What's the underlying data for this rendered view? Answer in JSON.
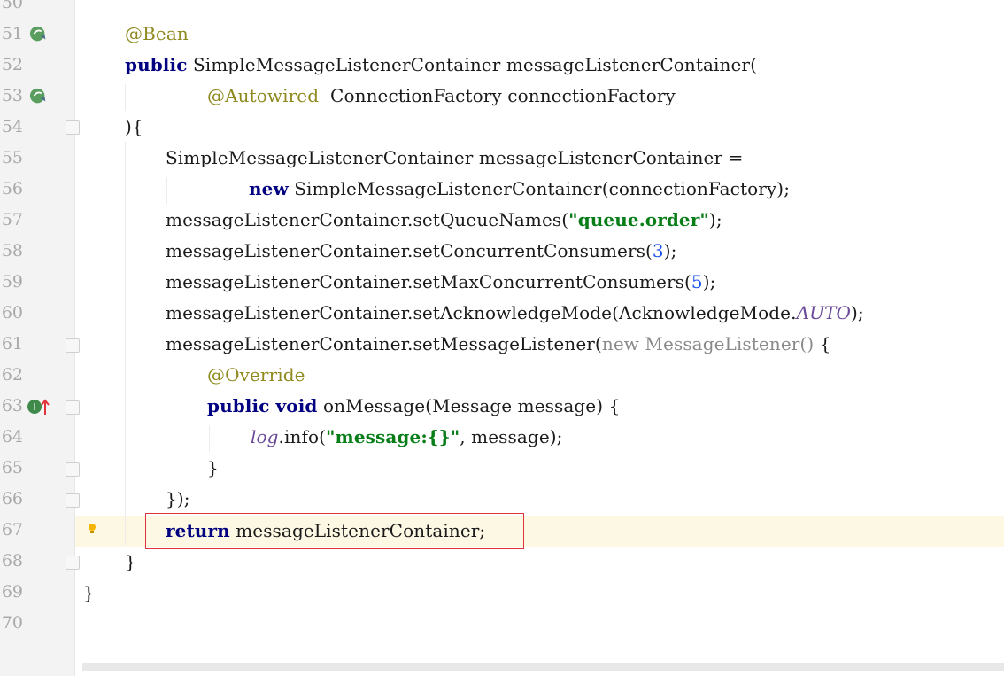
{
  "lines": [
    {
      "num": "50"
    },
    {
      "num": "51"
    },
    {
      "num": "52"
    },
    {
      "num": "53"
    },
    {
      "num": "54"
    },
    {
      "num": "55"
    },
    {
      "num": "56"
    },
    {
      "num": "57"
    },
    {
      "num": "58"
    },
    {
      "num": "59"
    },
    {
      "num": "60"
    },
    {
      "num": "61"
    },
    {
      "num": "62"
    },
    {
      "num": "63"
    },
    {
      "num": "64"
    },
    {
      "num": "65"
    },
    {
      "num": "66"
    },
    {
      "num": "67"
    },
    {
      "num": "68"
    },
    {
      "num": "69"
    },
    {
      "num": "70"
    }
  ],
  "code": {
    "l51_ann": "@Bean",
    "l52_kw": "public",
    "l52_rest": " SimpleMessageListenerContainer messageListenerContainer(",
    "l53_ann": "@Autowired",
    "l53_rest": "  ConnectionFactory connectionFactory",
    "l54": "){",
    "l55": "SimpleMessageListenerContainer messageListenerContainer =",
    "l56_kw": "new",
    "l56_rest": " SimpleMessageListenerContainer(connectionFactory);",
    "l57_a": "messageListenerContainer.setQueueNames(",
    "l57_str": "\"queue.order\"",
    "l57_b": ");",
    "l58_a": "messageListenerContainer.setConcurrentConsumers(",
    "l58_num": "3",
    "l58_b": ");",
    "l59_a": "messageListenerContainer.setMaxConcurrentConsumers(",
    "l59_num": "5",
    "l59_b": ");",
    "l60_a": "messageListenerContainer.setAcknowledgeMode(AcknowledgeMode.",
    "l60_it": "AUTO",
    "l60_b": ");",
    "l61_a": "messageListenerContainer.setMessageListener(",
    "l61_grey": "new MessageListener()",
    "l61_b": " {",
    "l62_ann": "@Override",
    "l63_kw": "public void",
    "l63_rest": " onMessage(Message message) {",
    "l64_it": "log",
    "l64_a": ".info(",
    "l64_str": "\"message:{}\"",
    "l64_b": ", message);",
    "l65": "}",
    "l66": "});",
    "l67_kw": "return",
    "l67_rest": " messageListenerContainer;",
    "l68": "}",
    "l69": "}"
  },
  "gutter_icons": {
    "bean_icon_51": "spring-bean-icon",
    "bean_icon_53": "spring-autowired-icon",
    "override_icon_63": "implements-method-icon",
    "override_badge": "I",
    "bulb_icon_67": "intention-bulb-icon"
  },
  "colors": {
    "keyword": "#000080",
    "annotation": "#8f8a20",
    "string": "#067d17",
    "number": "#1750eb",
    "highlight_border": "#e0343c",
    "current_line": "#fdf8e3"
  }
}
